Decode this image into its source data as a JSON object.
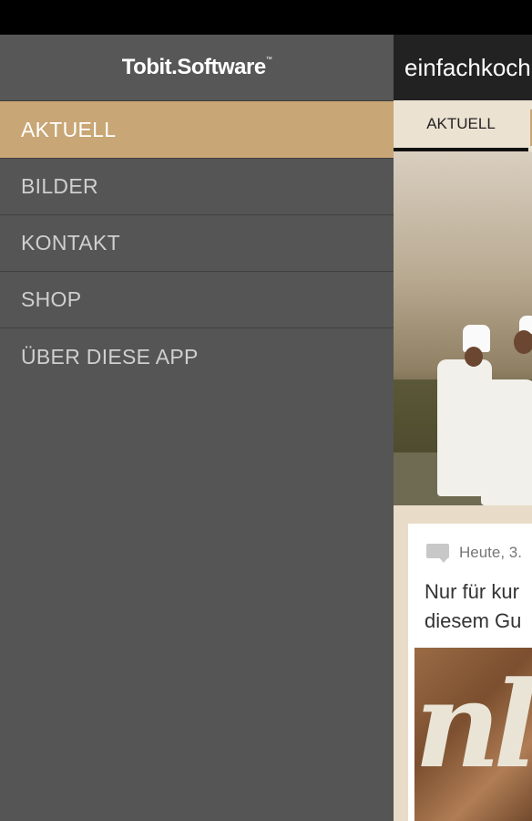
{
  "drawer": {
    "logo_text": "Tobit.Software",
    "logo_tm": "™",
    "items": [
      {
        "label": "AKTUELL",
        "active": true
      },
      {
        "label": "BILDER",
        "active": false
      },
      {
        "label": "KONTAKT",
        "active": false
      },
      {
        "label": "SHOP",
        "active": false
      },
      {
        "label": "ÜBER DIESE APP",
        "active": false
      }
    ]
  },
  "content": {
    "app_title": "einfachkoch",
    "tab_label": "AKTUELL",
    "post": {
      "meta": "Heute, 3.",
      "headline_line1": "Nur für kur",
      "headline_line2": "diesem Gu",
      "thumb_text": "nl"
    }
  },
  "colors": {
    "drawer_bg": "#555555",
    "active_item": "#c8a675",
    "app_bar": "#222222",
    "content_bg": "#e8dcc8"
  }
}
